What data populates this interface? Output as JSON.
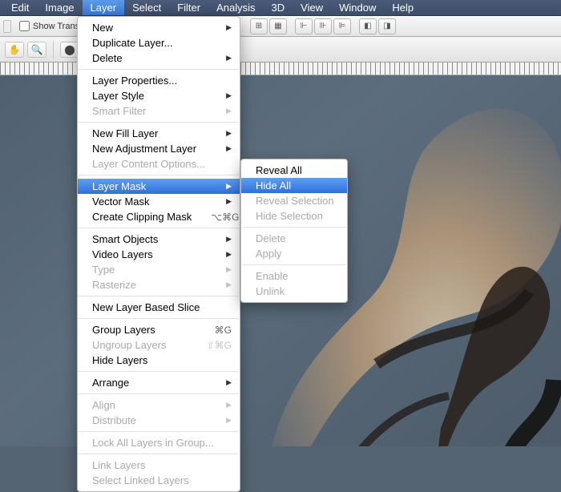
{
  "menubar": {
    "items": [
      {
        "label": "Edit"
      },
      {
        "label": "Image"
      },
      {
        "label": "Layer",
        "active": true
      },
      {
        "label": "Select"
      },
      {
        "label": "Filter"
      },
      {
        "label": "Analysis"
      },
      {
        "label": "3D"
      },
      {
        "label": "View"
      },
      {
        "label": "Window"
      },
      {
        "label": "Help"
      }
    ]
  },
  "options": {
    "show_transform_label": "Show Transfor"
  },
  "layer_menu": [
    {
      "label": "New",
      "submenu": true
    },
    {
      "label": "Duplicate Layer..."
    },
    {
      "label": "Delete",
      "submenu": true
    },
    {
      "sep": true
    },
    {
      "label": "Layer Properties..."
    },
    {
      "label": "Layer Style",
      "submenu": true
    },
    {
      "label": "Smart Filter",
      "submenu": true,
      "disabled": true
    },
    {
      "sep": true
    },
    {
      "label": "New Fill Layer",
      "submenu": true
    },
    {
      "label": "New Adjustment Layer",
      "submenu": true
    },
    {
      "label": "Layer Content Options...",
      "disabled": true
    },
    {
      "sep": true
    },
    {
      "label": "Layer Mask",
      "submenu": true,
      "highlight": true
    },
    {
      "label": "Vector Mask",
      "submenu": true
    },
    {
      "label": "Create Clipping Mask",
      "shortcut": "⌥⌘G"
    },
    {
      "sep": true
    },
    {
      "label": "Smart Objects",
      "submenu": true
    },
    {
      "label": "Video Layers",
      "submenu": true
    },
    {
      "label": "Type",
      "submenu": true,
      "disabled": true
    },
    {
      "label": "Rasterize",
      "submenu": true,
      "disabled": true
    },
    {
      "sep": true
    },
    {
      "label": "New Layer Based Slice"
    },
    {
      "sep": true
    },
    {
      "label": "Group Layers",
      "shortcut": "⌘G"
    },
    {
      "label": "Ungroup Layers",
      "shortcut": "⇧⌘G",
      "disabled": true
    },
    {
      "label": "Hide Layers"
    },
    {
      "sep": true
    },
    {
      "label": "Arrange",
      "submenu": true
    },
    {
      "sep": true
    },
    {
      "label": "Align",
      "submenu": true,
      "disabled": true
    },
    {
      "label": "Distribute",
      "submenu": true,
      "disabled": true
    },
    {
      "sep": true
    },
    {
      "label": "Lock All Layers in Group...",
      "disabled": true
    },
    {
      "sep": true
    },
    {
      "label": "Link Layers",
      "disabled": true
    },
    {
      "label": "Select Linked Layers",
      "disabled": true
    }
  ],
  "layer_mask_submenu": [
    {
      "label": "Reveal All"
    },
    {
      "label": "Hide All",
      "highlight": true
    },
    {
      "label": "Reveal Selection",
      "disabled": true
    },
    {
      "label": "Hide Selection",
      "disabled": true
    },
    {
      "sep": true
    },
    {
      "label": "Delete",
      "disabled": true
    },
    {
      "label": "Apply",
      "disabled": true
    },
    {
      "sep": true
    },
    {
      "label": "Enable",
      "disabled": true
    },
    {
      "label": "Unlink",
      "disabled": true
    }
  ],
  "icons": {
    "arrow_right": "▶"
  }
}
